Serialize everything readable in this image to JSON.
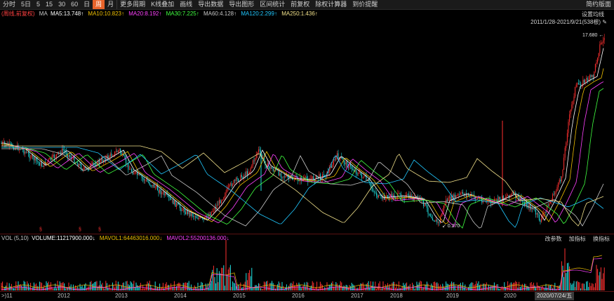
{
  "toolbar": {
    "items": [
      "分时",
      "5日",
      "5",
      "15",
      "30",
      "60",
      "日",
      "周",
      "月",
      "更多周期",
      "K线叠加",
      "画线",
      "导出数据",
      "导出图形",
      "区间统计",
      "前复权",
      "除权计算器",
      "到价提醒"
    ],
    "active_index": 7,
    "right_label": "简约版面"
  },
  "main": {
    "adjust_label": "(周线,前复权)",
    "ma_label": "MA",
    "ma": [
      {
        "label": "MA5:13.748↑",
        "color": "#ffffff"
      },
      {
        "label": "MA10:10.823↑",
        "color": "#f0c000"
      },
      {
        "label": "MA20:8.192↑",
        "color": "#ff40ff"
      },
      {
        "label": "MA30:7.225↑",
        "color": "#40ff40"
      },
      {
        "label": "MA60:4.128↑",
        "color": "#c8c8c8"
      },
      {
        "label": "MA120:2.299↑",
        "color": "#20c8ff"
      },
      {
        "label": "MA250:1.436↑",
        "color": "#f0e08a"
      }
    ],
    "settings_label": "设置均线",
    "date_range": "2011/1/28-2021/9/21(538根)",
    "max_label": "17.680",
    "min_label": "0.270",
    "markers": [
      "§",
      "§",
      "§"
    ]
  },
  "volume": {
    "label": "VOL (5,10)",
    "volume_value": "VOLUME:11217900.000↓",
    "mavol1": "MAVOL1:64463016.000↓",
    "mavol2": "MAVOL2:55200136.000↓",
    "btn_params": "改参数",
    "btn_add": "加指标",
    "btn_switch": "换指标"
  },
  "xaxis": {
    "labels": [
      ">)11",
      "2012",
      "2013",
      "2014",
      "2015",
      "2016",
      "2017",
      "2018",
      "2019",
      "2020"
    ],
    "highlight": "2020/07/24/五"
  },
  "colors": {
    "up": "#ff3030",
    "down": "#20e0e0",
    "bg": "#000000",
    "accent": "#e8632a"
  }
}
